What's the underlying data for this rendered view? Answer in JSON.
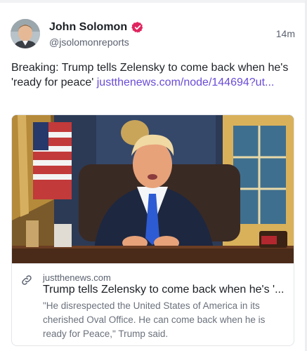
{
  "post": {
    "author_name": "John Solomon",
    "author_handle": "@jsolomonreports",
    "timestamp": "14m",
    "verified_icon": "verified-badge-icon",
    "verified_color": "#e0245e",
    "text_prefix": "Breaking: Trump tells Zelensky to come back when he's 'ready for peace' ",
    "link_text": "justthenews.com/node/144694?ut...",
    "link_color": "#6a4bd6"
  },
  "link_card": {
    "domain": "justthenews.com",
    "title": "Trump tells Zelensky to come back when he's '...",
    "description": "\"He disrespected the United States of America in its cherished Oval Office. He can come back when he is ready for Peace,\" Trump said.",
    "link_icon": "link-chain-icon"
  }
}
